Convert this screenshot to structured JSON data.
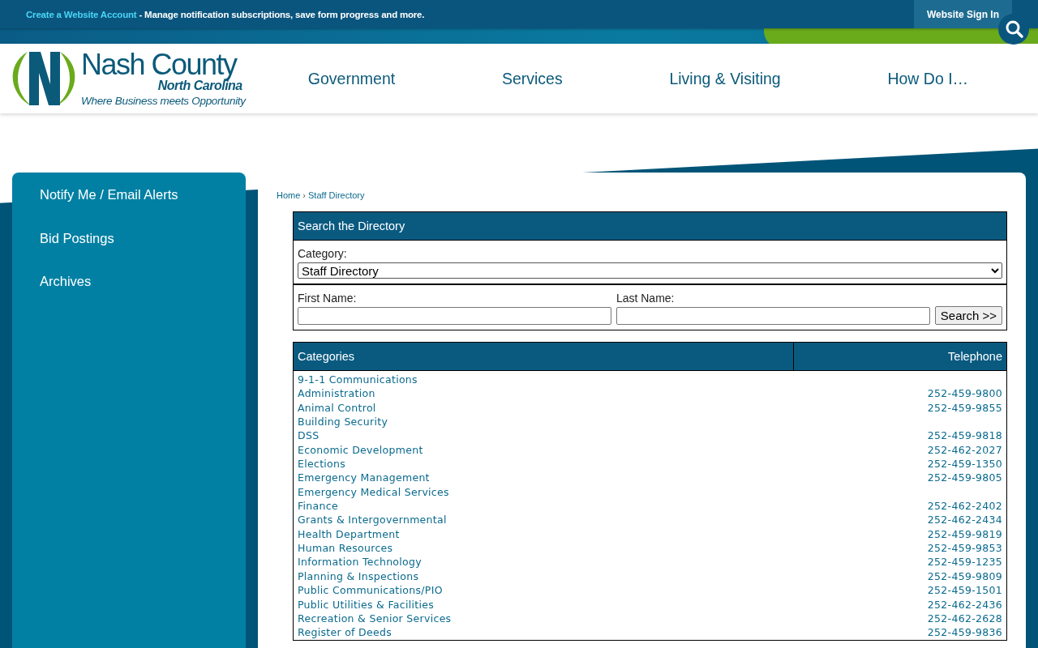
{
  "top_bar": {
    "link": "Create a Website Account",
    "message": " - Manage notification subscriptions, save form progress and more.",
    "sign_in": "Website Sign In"
  },
  "logo": {
    "name": "Nash County",
    "state": "North Carolina",
    "tagline": "Where Business meets Opportunity"
  },
  "nav": [
    "Government",
    "Services",
    "Living & Visiting",
    "How Do I…"
  ],
  "sidebar": {
    "items": [
      "Notify Me / Email Alerts",
      "Bid Postings",
      "Archives"
    ]
  },
  "breadcrumb": [
    "Home",
    "Staff Directory"
  ],
  "breadcrumb_separator": "›",
  "search_form": {
    "title": "Search the Directory",
    "category_label": "Category:",
    "category_value": "Staff Directory",
    "first_name_label": "First Name:",
    "last_name_label": "Last Name:",
    "button": "Search >>"
  },
  "table": {
    "columns": [
      "Categories",
      "Telephone"
    ],
    "rows": [
      {
        "name": "9-1-1 Communications"
      },
      {
        "name": "Administration",
        "phone": "252-459-9800"
      },
      {
        "name": "Animal Control",
        "phone": "252-459-9855"
      },
      {
        "name": "Building Security"
      },
      {
        "name": "DSS",
        "phone": "252-459-9818"
      },
      {
        "name": "Economic Development",
        "phone": "252-462-2027"
      },
      {
        "name": "Elections",
        "phone": "252-459-1350"
      },
      {
        "name": "Emergency Management",
        "phone": "252-459-9805"
      },
      {
        "name": "Emergency Medical Services"
      },
      {
        "name": "Finance",
        "phone": "252-462-2402"
      },
      {
        "name": "Grants & Intergovernmental",
        "phone": "252-462-2434"
      },
      {
        "name": "Health Department",
        "phone": "252-459-9819"
      },
      {
        "name": "Human Resources",
        "phone": "252-459-9853"
      },
      {
        "name": "Information Technology",
        "phone": "252-459-1235"
      },
      {
        "name": "Planning & Inspections",
        "phone": "252-459-9809"
      },
      {
        "name": "Public Communications/PIO",
        "phone": "252-459-1501"
      },
      {
        "name": "Public Utilities & Facilities",
        "phone": "252-462-2436"
      },
      {
        "name": "Recreation & Senior Services",
        "phone": "252-462-2628"
      },
      {
        "name": "Register of Deeds",
        "phone": "252-459-9836"
      }
    ]
  }
}
